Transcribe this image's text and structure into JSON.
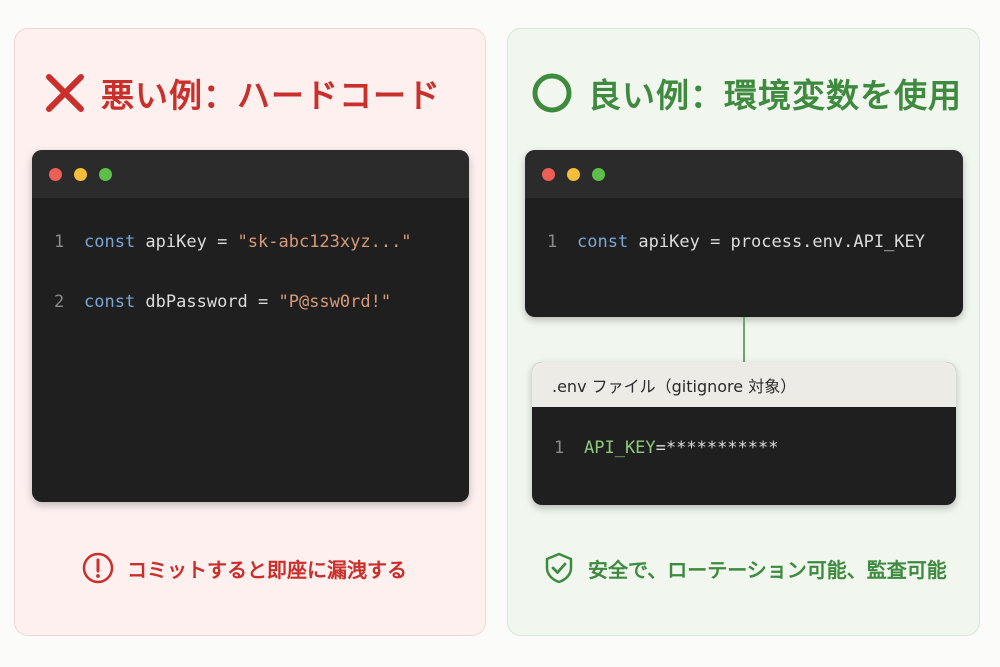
{
  "bad": {
    "title": "悪い例：ハードコード",
    "icon": "cross-icon",
    "color": "#c9302c",
    "code": [
      {
        "num": "1",
        "kw": "const",
        "rest": " apiKey = ",
        "str": "\"sk-abc123xyz...\""
      },
      {
        "num": "2",
        "kw": "const",
        "rest": " dbPassword = ",
        "str": "\"P@ssw0rd!\""
      }
    ],
    "footer": "コミットすると即座に漏洩する",
    "footer_icon": "alert-circle-icon"
  },
  "good": {
    "title": "良い例：環境変数を使用",
    "icon": "circle-icon",
    "color": "#3e8a3e",
    "code": [
      {
        "num": "1",
        "kw": "const",
        "rest": " apiKey = process.env.API_KEY"
      }
    ],
    "env_file": {
      "title": ".env ファイル（gitignore 対象）",
      "line": {
        "num": "1",
        "key": "API_KEY",
        "value": "=***********"
      }
    },
    "footer": "安全で、ローテーション可能、監査可能",
    "footer_icon": "shield-check-icon"
  },
  "window_dots": [
    "#ec5f56",
    "#f4bd3a",
    "#5fbd4a"
  ]
}
